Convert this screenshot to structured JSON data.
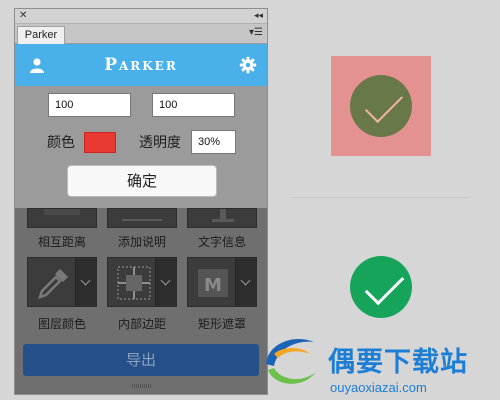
{
  "panel": {
    "tab_label": "Parker",
    "brand": "Parker",
    "width_value": "100",
    "height_value": "100",
    "color_label": "颜色",
    "color_value": "#e83a33",
    "opacity_label": "透明度",
    "opacity_value": "30%",
    "confirm_label": "确定",
    "tools": [
      {
        "label": "相互距离"
      },
      {
        "label": "添加说明"
      },
      {
        "label": "文字信息"
      },
      {
        "label": "图层颜色"
      },
      {
        "label": "内部边距"
      },
      {
        "label": "矩形遮罩"
      }
    ],
    "export_label": "导出"
  },
  "colors": {
    "header": "#4ab0ea",
    "hover_state_bg": "#e39191",
    "hover_state_circle": "#697848",
    "normal_circle": "#16a35a",
    "export_button": "#25508a"
  },
  "watermark": {
    "text": "偶要下载站",
    "url": "ouyaoxiazai.com"
  }
}
